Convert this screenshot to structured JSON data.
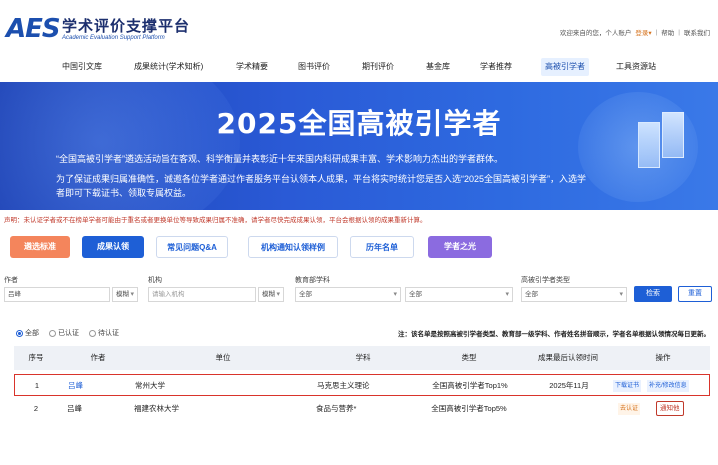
{
  "header": {
    "logo_mark": "AES",
    "title": "学术评价支撑平台",
    "subtitle": "Academic Evaluation Support Platform",
    "welcome": "欢迎来自的您，个人账户",
    "login": "登录",
    "login_arrow": "▾",
    "help": "帮助",
    "contact": "联系我们"
  },
  "nav": {
    "items": [
      "中国引文库",
      "成果统计(学术知析)",
      "学术精要",
      "图书评价",
      "期刊评价",
      "基金库",
      "学者推荐",
      "高被引学者",
      "工具资源站"
    ],
    "active": "高被引学者"
  },
  "banner": {
    "title": "2025全国高被引学者",
    "line1": "“全国高被引学者”遴选活动旨在客观、科学衡量并表彰近十年来国内科研成果丰富、学术影响力杰出的学者群体。",
    "line2": "为了保证成果归属准确性，诚邀各位学者通过作者服务平台认领本人成果，平台将实时统计您是否入选“2025全国高被引学者”，入选学",
    "line3": "者即可下载证书、领取专属权益。"
  },
  "notice": "声明：未认证学者或不在榜单学者可能由于重名或者更换单位等导致成果归属不准确，请学者尽快完成成果认领，平台会根据认领的成果重新计算。",
  "actions": [
    "遴选标准",
    "成果认领",
    "常见问题Q&A",
    "机构通知认领样例",
    "历年名单",
    "学者之光"
  ],
  "filters": {
    "author_label": "作者",
    "author_value": "吕峰",
    "author_mode": "模糊",
    "org_label": "机构",
    "org_placeholder": "请输入机构",
    "org_mode": "模糊",
    "subject_label": "教育部学科",
    "subject_value1": "全部",
    "subject_value2": "全部",
    "type_label": "高被引学者类型",
    "type_value": "全部",
    "search_btn": "检索",
    "reset_btn": "重置"
  },
  "radios": [
    {
      "label": "全部",
      "selected": true
    },
    {
      "label": "已认证",
      "selected": false
    },
    {
      "label": "待认证",
      "selected": false
    }
  ],
  "note": "注：该名单是按照高被引学者类型、教育部一级学科、作者姓名拼音顺示，学者名单根据认领情况每日更新。",
  "table": {
    "columns": [
      "序号",
      "作者",
      "单位",
      "学科",
      "类型",
      "成果最后认领时间",
      "操作"
    ],
    "rows": [
      {
        "no": "1",
        "author": "吕峰",
        "org": "常州大学",
        "subject": "马克思主义理论",
        "type": "全国高被引学者Top1%",
        "time": "2025年11月",
        "op1": "下载证书",
        "op2": "补充/修改信息"
      },
      {
        "no": "2",
        "author": "吕峰",
        "org": "福建农林大学",
        "subject": "食品与营养*",
        "type": "全国高被引学者Top5%",
        "time": "",
        "op1": "去认证",
        "op2": "通知他"
      }
    ]
  },
  "colors": {
    "brand": "#1c4fae",
    "primary": "#1e5fd6",
    "highlight_border": "#d9342b",
    "notice": "#c0392b"
  }
}
